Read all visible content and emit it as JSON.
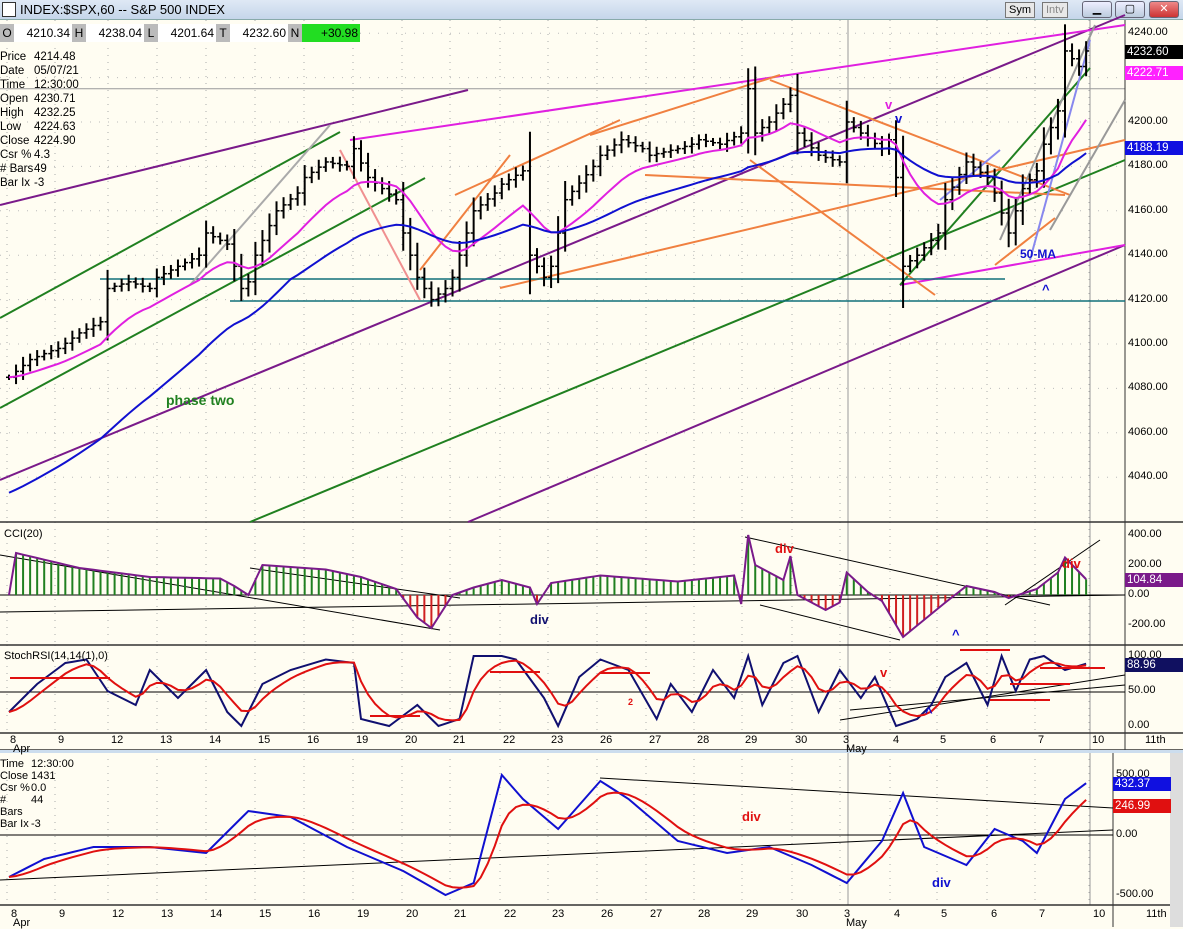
{
  "window": {
    "title": "INDEX:$SPX,60 -- S&P 500 INDEX",
    "sym_label": "Sym",
    "intv_label": "Intv",
    "minimize": "▁",
    "maximize": "▢",
    "close": "✕"
  },
  "ohlc_bar": {
    "o_label": "O",
    "o": "4210.34",
    "h_label": "H",
    "h": "4238.04",
    "l_label": "L",
    "l": "4201.64",
    "t_label": "T",
    "t": "4232.60",
    "n_label": "N",
    "n": "+30.98"
  },
  "info": [
    [
      "Price",
      "4214.48"
    ],
    [
      "Date",
      "05/07/21"
    ],
    [
      "Time",
      "12:30:00"
    ],
    [
      "Open",
      "4230.71"
    ],
    [
      "High",
      "4232.25"
    ],
    [
      "Low",
      "4224.63"
    ],
    [
      "Close",
      "4224.90"
    ],
    [
      "Csr %",
      "4.3"
    ],
    [
      "# Bars",
      "49"
    ],
    [
      "Bar Ix",
      "-3"
    ]
  ],
  "info2": [
    [
      "Time",
      "12:30:00"
    ],
    [
      "Close",
      "1431"
    ],
    [
      "Csr %",
      "0.0"
    ],
    [
      "# Bars",
      "44"
    ],
    [
      "Bar Ix",
      "-3"
    ]
  ],
  "colors": {
    "price": "#000000",
    "ma_short": "#e020e0",
    "ma_long": "#1010d0",
    "cci": "#7a1a8a",
    "stoch": "#101070",
    "signal": "#e01010",
    "up": "#208020",
    "down": "#d02020"
  },
  "chart_data": {
    "type": "line",
    "title": "INDEX:$SPX,60 -- S&P 500 INDEX",
    "x_ticks": [
      "8",
      "9",
      "12",
      "13",
      "14",
      "15",
      "16",
      "19",
      "20",
      "21",
      "22",
      "23",
      "26",
      "27",
      "28",
      "29",
      "30",
      "3",
      "4",
      "5",
      "6",
      "7",
      "10",
      "11th"
    ],
    "month_labels": {
      "apr": "Apr",
      "may": "May"
    },
    "price": {
      "ylim": [
        4020,
        4245
      ],
      "y_ticks": [
        "4240.00",
        "4220.00",
        "4200.00",
        "4180.00",
        "4160.00",
        "4140.00",
        "4120.00",
        "4100.00",
        "4080.00",
        "4060.00",
        "4040.00"
      ],
      "path": [
        [
          0,
          4085
        ],
        [
          3,
          4093
        ],
        [
          6,
          4097
        ],
        [
          7,
          4098
        ],
        [
          10,
          4105
        ],
        [
          13,
          4110
        ],
        [
          14,
          4125
        ],
        [
          17,
          4128
        ],
        [
          20,
          4125
        ],
        [
          21,
          4130
        ],
        [
          24,
          4135
        ],
        [
          27,
          4140
        ],
        [
          28,
          4150
        ],
        [
          31,
          4145
        ],
        [
          33,
          4125
        ],
        [
          34,
          4128
        ],
        [
          35,
          4140
        ],
        [
          38,
          4160
        ],
        [
          41,
          4168
        ],
        [
          42,
          4175
        ],
        [
          45,
          4182
        ],
        [
          48,
          4180
        ],
        [
          49,
          4188
        ],
        [
          51,
          4175
        ],
        [
          55,
          4165
        ],
        [
          56,
          4150
        ],
        [
          58,
          4130
        ],
        [
          60,
          4120
        ],
        [
          62,
          4125
        ],
        [
          63,
          4130
        ],
        [
          66,
          4160
        ],
        [
          69,
          4168
        ],
        [
          70,
          4172
        ],
        [
          73,
          4178
        ],
        [
          74,
          4140
        ],
        [
          76,
          4130
        ],
        [
          77,
          4135
        ],
        [
          79,
          4165
        ],
        [
          83,
          4180
        ],
        [
          84,
          4185
        ],
        [
          87,
          4192
        ],
        [
          90,
          4188
        ],
        [
          91,
          4185
        ],
        [
          95,
          4188
        ],
        [
          97,
          4190
        ],
        [
          98,
          4192
        ],
        [
          101,
          4190
        ],
        [
          104,
          4195
        ],
        [
          105,
          4215
        ],
        [
          106,
          4195
        ],
        [
          108,
          4200
        ],
        [
          111,
          4212
        ],
        [
          112,
          4195
        ],
        [
          115,
          4185
        ],
        [
          118,
          4182
        ],
        [
          119,
          4200
        ],
        [
          121,
          4195
        ],
        [
          124,
          4188
        ],
        [
          125,
          4192
        ],
        [
          126,
          4175
        ],
        [
          127,
          4135
        ],
        [
          129,
          4140
        ],
        [
          132,
          4150
        ],
        [
          133,
          4165
        ],
        [
          136,
          4182
        ],
        [
          139,
          4175
        ],
        [
          140,
          4168
        ],
        [
          142,
          4150
        ],
        [
          144,
          4170
        ],
        [
          146,
          4178
        ],
        [
          147,
          4190
        ],
        [
          149,
          4205
        ],
        [
          150,
          4232
        ],
        [
          152,
          4225
        ],
        [
          153,
          4232
        ]
      ],
      "last": "4232.60",
      "ma_short_last": "4222.71",
      "ma_long_last": "4188.19",
      "annotations": {
        "phase": "phase two",
        "ma50": "50-MA",
        "v1": "v",
        "v2": "v",
        "caret": "^"
      }
    },
    "cci": {
      "label": "CCI(20)",
      "ylim": [
        -300,
        450
      ],
      "y_ticks": [
        "400.00",
        "200.00",
        "0.00",
        "-200.00"
      ],
      "last": "104.84",
      "path": [
        [
          0,
          0
        ],
        [
          1,
          280
        ],
        [
          10,
          180
        ],
        [
          20,
          120
        ],
        [
          30,
          110
        ],
        [
          32,
          60
        ],
        [
          34,
          0
        ],
        [
          36,
          200
        ],
        [
          45,
          170
        ],
        [
          50,
          120
        ],
        [
          55,
          40
        ],
        [
          58,
          -150
        ],
        [
          60,
          -220
        ],
        [
          63,
          0
        ],
        [
          66,
          50
        ],
        [
          70,
          100
        ],
        [
          74,
          50
        ],
        [
          75,
          -60
        ],
        [
          77,
          80
        ],
        [
          84,
          130
        ],
        [
          95,
          90
        ],
        [
          103,
          130
        ],
        [
          104,
          -60
        ],
        [
          105,
          400
        ],
        [
          106,
          200
        ],
        [
          110,
          100
        ],
        [
          111,
          260
        ],
        [
          112,
          0
        ],
        [
          116,
          -100
        ],
        [
          118,
          -50
        ],
        [
          119,
          150
        ],
        [
          122,
          20
        ],
        [
          124,
          -40
        ],
        [
          127,
          -280
        ],
        [
          133,
          -50
        ],
        [
          136,
          60
        ],
        [
          140,
          20
        ],
        [
          142,
          -20
        ],
        [
          146,
          40
        ],
        [
          149,
          150
        ],
        [
          150,
          250
        ],
        [
          153,
          105
        ]
      ],
      "annotations": {
        "div1": "div",
        "div2": "div",
        "div3": "div",
        "caret": "^"
      }
    },
    "stoch_rsi": {
      "label": "StochRSI(14,14(1),0)",
      "ylim": [
        0,
        100
      ],
      "y_ticks": [
        "100.00",
        "50.00",
        "0.00"
      ],
      "last": "88.96",
      "path": [
        [
          0,
          20
        ],
        [
          4,
          60
        ],
        [
          8,
          90
        ],
        [
          11,
          95
        ],
        [
          14,
          50
        ],
        [
          18,
          30
        ],
        [
          20,
          80
        ],
        [
          24,
          40
        ],
        [
          28,
          80
        ],
        [
          31,
          20
        ],
        [
          33,
          0
        ],
        [
          36,
          60
        ],
        [
          40,
          80
        ],
        [
          45,
          95
        ],
        [
          49,
          90
        ],
        [
          50,
          10
        ],
        [
          54,
          0
        ],
        [
          58,
          30
        ],
        [
          61,
          0
        ],
        [
          64,
          10
        ],
        [
          66,
          100
        ],
        [
          70,
          100
        ],
        [
          72,
          95
        ],
        [
          76,
          40
        ],
        [
          78,
          0
        ],
        [
          81,
          70
        ],
        [
          84,
          95
        ],
        [
          88,
          80
        ],
        [
          92,
          10
        ],
        [
          94,
          60
        ],
        [
          97,
          20
        ],
        [
          100,
          80
        ],
        [
          103,
          40
        ],
        [
          105,
          100
        ],
        [
          107,
          30
        ],
        [
          110,
          90
        ],
        [
          112,
          100
        ],
        [
          115,
          20
        ],
        [
          118,
          80
        ],
        [
          121,
          40
        ],
        [
          123,
          70
        ],
        [
          126,
          0
        ],
        [
          129,
          10
        ],
        [
          131,
          30
        ],
        [
          133,
          70
        ],
        [
          136,
          90
        ],
        [
          139,
          30
        ],
        [
          141,
          100
        ],
        [
          143,
          50
        ],
        [
          145,
          95
        ],
        [
          147,
          100
        ],
        [
          150,
          80
        ],
        [
          153,
          89
        ]
      ],
      "annotations": {
        "v": "v",
        "caret": "^",
        "two": "2"
      }
    },
    "oscillator": {
      "ylim": [
        -500,
        500
      ],
      "y_ticks": [
        "500.00",
        "0.00",
        "-500.00"
      ],
      "last_blue": "432.37",
      "last_red": "246.99",
      "path": [
        [
          0,
          -350
        ],
        [
          5,
          -200
        ],
        [
          12,
          -100
        ],
        [
          20,
          -100
        ],
        [
          28,
          -150
        ],
        [
          34,
          200
        ],
        [
          40,
          150
        ],
        [
          48,
          -100
        ],
        [
          56,
          -300
        ],
        [
          62,
          -500
        ],
        [
          66,
          -400
        ],
        [
          70,
          500
        ],
        [
          73,
          300
        ],
        [
          78,
          50
        ],
        [
          84,
          450
        ],
        [
          88,
          300
        ],
        [
          95,
          -50
        ],
        [
          102,
          -150
        ],
        [
          108,
          -100
        ],
        [
          114,
          -250
        ],
        [
          119,
          -400
        ],
        [
          124,
          -50
        ],
        [
          127,
          350
        ],
        [
          130,
          -100
        ],
        [
          136,
          -250
        ],
        [
          140,
          50
        ],
        [
          144,
          -50
        ],
        [
          146,
          -150
        ],
        [
          150,
          300
        ],
        [
          153,
          432
        ]
      ],
      "annotations": {
        "div1": "div",
        "div2": "div"
      }
    }
  }
}
